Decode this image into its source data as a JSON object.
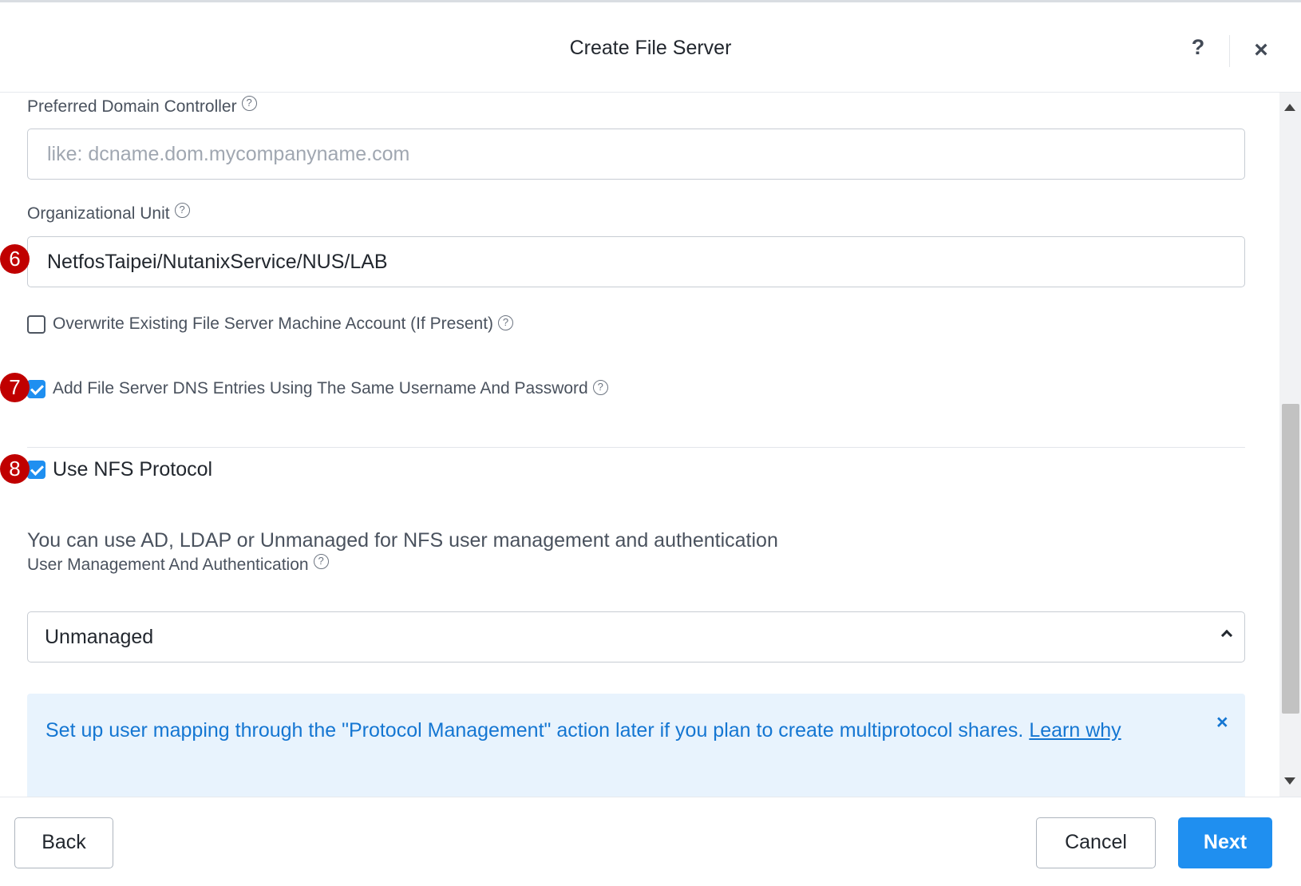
{
  "header": {
    "title": "Create File Server",
    "help_label": "?",
    "close_label": "×"
  },
  "form": {
    "preferred_dc": {
      "label": "Preferred Domain Controller",
      "placeholder": "like: dcname.dom.mycompanyname.com",
      "value": ""
    },
    "org_unit": {
      "label": "Organizational Unit",
      "value": "NetfosTaipei/NutanixService/NUS/LAB"
    },
    "overwrite_account": {
      "label": "Overwrite Existing File Server Machine Account (If Present)",
      "checked": false
    },
    "add_dns_entries": {
      "label": "Add File Server DNS Entries Using The Same Username And Password",
      "checked": true
    },
    "use_nfs": {
      "label": "Use NFS Protocol",
      "checked": true
    },
    "nfs_description": "You can use AD, LDAP or Unmanaged for NFS user management and authentication",
    "user_mgmt": {
      "label": "User Management And Authentication",
      "selected": "Unmanaged"
    },
    "info_banner": {
      "text": "Set up user mapping through the \"Protocol Management\" action later if you plan to create multiprotocol shares. ",
      "link": "Learn why",
      "close_label": "×"
    }
  },
  "annotations": {
    "step6": "6",
    "step7": "7",
    "step8": "8"
  },
  "footer": {
    "back_label": "Back",
    "cancel_label": "Cancel",
    "next_label": "Next"
  },
  "colors": {
    "primary": "#1f8ff0",
    "info_bg": "#e8f3fd",
    "info_text": "#1476d2",
    "badge": "#c00000"
  },
  "help_icon_glyph": "?"
}
